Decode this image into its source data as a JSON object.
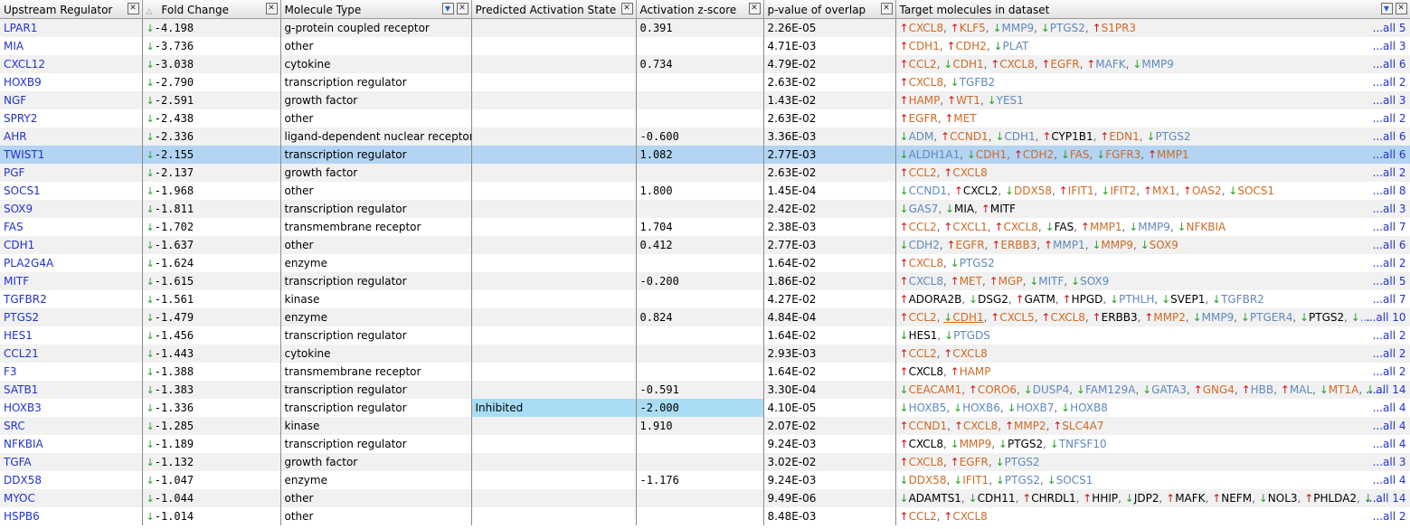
{
  "headers": [
    {
      "label": "Upstream Regulator",
      "buttons": [
        "x"
      ]
    },
    {
      "label": "Fold Change",
      "sort": "△",
      "buttons": [
        "x"
      ]
    },
    {
      "label": "Molecule Type",
      "buttons": [
        "filter",
        "x"
      ]
    },
    {
      "label": "Predicted Activation State",
      "buttons": [
        "x"
      ]
    },
    {
      "label": "Activation z-score",
      "buttons": [
        "x"
      ]
    },
    {
      "label": "p-value of overlap",
      "buttons": [
        "x"
      ]
    },
    {
      "label": "Target molecules in dataset",
      "buttons": [
        "filter",
        "x"
      ]
    }
  ],
  "rows": [
    {
      "regulator": "LPAR1",
      "fold": "-4.198",
      "type": "g-protein coupled receptor",
      "state": "",
      "z": "0.391",
      "p": "2.26E-05",
      "all": "...all 5",
      "targets": [
        [
          "CXCL8",
          "u",
          "o"
        ],
        [
          "KLF5",
          "u",
          "o"
        ],
        [
          "MMP9",
          "d",
          "b"
        ],
        [
          "PTGS2",
          "d",
          "b"
        ],
        [
          "S1PR3",
          "u",
          "o"
        ]
      ]
    },
    {
      "regulator": "MIA",
      "fold": "-3.736",
      "type": "other",
      "state": "",
      "z": "",
      "p": "4.71E-03",
      "all": "...all 3",
      "targets": [
        [
          "CDH1",
          "u",
          "o"
        ],
        [
          "CDH2",
          "u",
          "o"
        ],
        [
          "PLAT",
          "d",
          "b"
        ]
      ]
    },
    {
      "regulator": "CXCL12",
      "fold": "-3.038",
      "type": "cytokine",
      "state": "",
      "z": "0.734",
      "p": "4.79E-02",
      "all": "...all 6",
      "targets": [
        [
          "CCL2",
          "u",
          "o"
        ],
        [
          "CDH1",
          "d",
          "o"
        ],
        [
          "CXCL8",
          "u",
          "o"
        ],
        [
          "EGFR",
          "u",
          "o"
        ],
        [
          "MAFK",
          "u",
          "b"
        ],
        [
          "MMP9",
          "d",
          "b"
        ]
      ]
    },
    {
      "regulator": "HOXB9",
      "fold": "-2.790",
      "type": "transcription regulator",
      "state": "",
      "z": "",
      "p": "2.63E-02",
      "all": "...all 2",
      "targets": [
        [
          "CXCL8",
          "u",
          "o"
        ],
        [
          "TGFB2",
          "d",
          "b"
        ]
      ]
    },
    {
      "regulator": "NGF",
      "fold": "-2.591",
      "type": "growth factor",
      "state": "",
      "z": "",
      "p": "1.43E-02",
      "all": "...all 3",
      "targets": [
        [
          "HAMP",
          "u",
          "o"
        ],
        [
          "WT1",
          "u",
          "o"
        ],
        [
          "YES1",
          "d",
          "b"
        ]
      ]
    },
    {
      "regulator": "SPRY2",
      "fold": "-2.438",
      "type": "other",
      "state": "",
      "z": "",
      "p": "2.63E-02",
      "all": "...all 2",
      "targets": [
        [
          "EGFR",
          "u",
          "o"
        ],
        [
          "MET",
          "u",
          "o"
        ]
      ]
    },
    {
      "regulator": "AHR",
      "fold": "-2.336",
      "type": "ligand-dependent nuclear receptor",
      "state": "",
      "z": "-0.600",
      "p": "3.36E-03",
      "all": "...all 6",
      "targets": [
        [
          "ADM",
          "d",
          "b"
        ],
        [
          "CCND1",
          "u",
          "o"
        ],
        [
          "CDH1",
          "d",
          "b"
        ],
        [
          "CYP1B1",
          "u",
          "k"
        ],
        [
          "EDN1",
          "u",
          "o"
        ],
        [
          "PTGS2",
          "d",
          "b"
        ]
      ]
    },
    {
      "regulator": "TWIST1",
      "fold": "-2.155",
      "type": "transcription regulator",
      "state": "",
      "z": "1.082",
      "p": "2.77E-03",
      "all": "...all 6",
      "selected": true,
      "targets": [
        [
          "ALDH1A1",
          "d",
          "b"
        ],
        [
          "CDH1",
          "d",
          "o"
        ],
        [
          "CDH2",
          "u",
          "o"
        ],
        [
          "FAS",
          "d",
          "o"
        ],
        [
          "FGFR3",
          "d",
          "o"
        ],
        [
          "MMP1",
          "u",
          "o"
        ]
      ]
    },
    {
      "regulator": "PGF",
      "fold": "-2.137",
      "type": "growth factor",
      "state": "",
      "z": "",
      "p": "2.63E-02",
      "all": "...all 2",
      "targets": [
        [
          "CCL2",
          "u",
          "o"
        ],
        [
          "CXCL8",
          "u",
          "o"
        ]
      ]
    },
    {
      "regulator": "SOCS1",
      "fold": "-1.968",
      "type": "other",
      "state": "",
      "z": "1.800",
      "p": "1.45E-04",
      "all": "...all 8",
      "targets": [
        [
          "CCND1",
          "d",
          "b"
        ],
        [
          "CXCL2",
          "u",
          "k"
        ],
        [
          "DDX58",
          "d",
          "o"
        ],
        [
          "IFIT1",
          "u",
          "o"
        ],
        [
          "IFIT2",
          "d",
          "o"
        ],
        [
          "MX1",
          "u",
          "o"
        ],
        [
          "OAS2",
          "u",
          "o"
        ],
        [
          "SOCS1",
          "d",
          "o"
        ]
      ]
    },
    {
      "regulator": "SOX9",
      "fold": "-1.811",
      "type": "transcription regulator",
      "state": "",
      "z": "",
      "p": "2.42E-02",
      "all": "...all 3",
      "targets": [
        [
          "GAS7",
          "d",
          "b"
        ],
        [
          "MIA",
          "d",
          "k"
        ],
        [
          "MITF",
          "u",
          "k"
        ]
      ]
    },
    {
      "regulator": "FAS",
      "fold": "-1.702",
      "type": "transmembrane receptor",
      "state": "",
      "z": "1.704",
      "p": "2.38E-03",
      "all": "...all 7",
      "targets": [
        [
          "CCL2",
          "u",
          "o"
        ],
        [
          "CXCL1",
          "u",
          "o"
        ],
        [
          "CXCL8",
          "u",
          "o"
        ],
        [
          "FAS",
          "d",
          "k"
        ],
        [
          "MMP1",
          "u",
          "o"
        ],
        [
          "MMP9",
          "d",
          "b"
        ],
        [
          "NFKBIA",
          "d",
          "o"
        ]
      ]
    },
    {
      "regulator": "CDH1",
      "fold": "-1.637",
      "type": "other",
      "state": "",
      "z": "0.412",
      "p": "2.77E-03",
      "all": "...all 6",
      "targets": [
        [
          "CDH2",
          "d",
          "b"
        ],
        [
          "EGFR",
          "u",
          "o"
        ],
        [
          "ERBB3",
          "u",
          "o"
        ],
        [
          "MMP1",
          "u",
          "b"
        ],
        [
          "MMP9",
          "d",
          "o"
        ],
        [
          "SOX9",
          "d",
          "o"
        ]
      ]
    },
    {
      "regulator": "PLA2G4A",
      "fold": "-1.624",
      "type": "enzyme",
      "state": "",
      "z": "",
      "p": "1.64E-02",
      "all": "...all 2",
      "targets": [
        [
          "CXCL8",
          "u",
          "o"
        ],
        [
          "PTGS2",
          "d",
          "b"
        ]
      ]
    },
    {
      "regulator": "MITF",
      "fold": "-1.615",
      "type": "transcription regulator",
      "state": "",
      "z": "-0.200",
      "p": "1.86E-02",
      "all": "...all 5",
      "targets": [
        [
          "CXCL8",
          "u",
          "b"
        ],
        [
          "MET",
          "u",
          "o"
        ],
        [
          "MGP",
          "u",
          "o"
        ],
        [
          "MITF",
          "d",
          "b"
        ],
        [
          "SOX9",
          "d",
          "b"
        ]
      ]
    },
    {
      "regulator": "TGFBR2",
      "fold": "-1.561",
      "type": "kinase",
      "state": "",
      "z": "",
      "p": "4.27E-02",
      "all": "...all 7",
      "targets": [
        [
          "ADORA2B",
          "u",
          "k"
        ],
        [
          "DSG2",
          "d",
          "k"
        ],
        [
          "GATM",
          "u",
          "k"
        ],
        [
          "HPGD",
          "u",
          "k"
        ],
        [
          "PTHLH",
          "d",
          "b"
        ],
        [
          "SVEP1",
          "d",
          "k"
        ],
        [
          "TGFBR2",
          "d",
          "b"
        ]
      ]
    },
    {
      "regulator": "PTGS2",
      "fold": "-1.479",
      "type": "enzyme",
      "state": "",
      "z": "0.824",
      "p": "4.84E-04",
      "all": "...all 10",
      "targets": [
        [
          "CCL2",
          "u",
          "o"
        ],
        [
          "CDH1",
          "d",
          "o",
          "ul"
        ],
        [
          "CXCL5",
          "u",
          "o"
        ],
        [
          "CXCL8",
          "u",
          "o"
        ],
        [
          "ERBB3",
          "u",
          "k"
        ],
        [
          "MMP2",
          "u",
          "o"
        ],
        [
          "MMP9",
          "d",
          "b"
        ],
        [
          "PTGER4",
          "d",
          "b"
        ],
        [
          "PTGS2",
          "d",
          "k"
        ],
        [
          "...",
          "d",
          "b"
        ]
      ]
    },
    {
      "regulator": "HES1",
      "fold": "-1.456",
      "type": "transcription regulator",
      "state": "",
      "z": "",
      "p": "1.64E-02",
      "all": "...all 2",
      "targets": [
        [
          "HES1",
          "d",
          "k"
        ],
        [
          "PTGDS",
          "d",
          "b"
        ]
      ]
    },
    {
      "regulator": "CCL21",
      "fold": "-1.443",
      "type": "cytokine",
      "state": "",
      "z": "",
      "p": "2.93E-03",
      "all": "...all 2",
      "targets": [
        [
          "CCL2",
          "u",
          "o"
        ],
        [
          "CXCL8",
          "u",
          "o"
        ]
      ]
    },
    {
      "regulator": "F3",
      "fold": "-1.388",
      "type": "transmembrane receptor",
      "state": "",
      "z": "",
      "p": "1.64E-02",
      "all": "...all 2",
      "targets": [
        [
          "CXCL8",
          "u",
          "k"
        ],
        [
          "HAMP",
          "u",
          "o"
        ]
      ]
    },
    {
      "regulator": "SATB1",
      "fold": "-1.383",
      "type": "transcription regulator",
      "state": "",
      "z": "-0.591",
      "p": "3.30E-04",
      "all": "...all 14",
      "targets": [
        [
          "CEACAM1",
          "d",
          "o"
        ],
        [
          "CORO6",
          "u",
          "o"
        ],
        [
          "DUSP4",
          "d",
          "b"
        ],
        [
          "FAM129A",
          "d",
          "b"
        ],
        [
          "GATA3",
          "d",
          "b"
        ],
        [
          "GNG4",
          "u",
          "o"
        ],
        [
          "HBB",
          "u",
          "b"
        ],
        [
          "MAL",
          "u",
          "b"
        ],
        [
          "MT1A",
          "d",
          "o"
        ],
        [
          "...",
          "d",
          "b"
        ]
      ]
    },
    {
      "regulator": "HOXB3",
      "fold": "-1.336",
      "type": "transcription regulator",
      "state": "Inhibited",
      "z": "-2.000",
      "p": "4.10E-05",
      "all": "...all 4",
      "inhibited": true,
      "targets": [
        [
          "HOXB5",
          "d",
          "b"
        ],
        [
          "HOXB6",
          "d",
          "b"
        ],
        [
          "HOXB7",
          "d",
          "b"
        ],
        [
          "HOXB8",
          "d",
          "b"
        ]
      ]
    },
    {
      "regulator": "SRC",
      "fold": "-1.285",
      "type": "kinase",
      "state": "",
      "z": "1.910",
      "p": "2.07E-02",
      "all": "...all 4",
      "targets": [
        [
          "CCND1",
          "u",
          "o"
        ],
        [
          "CXCL8",
          "u",
          "o"
        ],
        [
          "MMP2",
          "u",
          "o"
        ],
        [
          "SLC4A7",
          "u",
          "o"
        ]
      ]
    },
    {
      "regulator": "NFKBIA",
      "fold": "-1.189",
      "type": "transcription regulator",
      "state": "",
      "z": "",
      "p": "9.24E-03",
      "all": "...all 4",
      "targets": [
        [
          "CXCL8",
          "u",
          "k"
        ],
        [
          "MMP9",
          "d",
          "o"
        ],
        [
          "PTGS2",
          "d",
          "k"
        ],
        [
          "TNFSF10",
          "d",
          "b"
        ]
      ]
    },
    {
      "regulator": "TGFA",
      "fold": "-1.132",
      "type": "growth factor",
      "state": "",
      "z": "",
      "p": "3.02E-02",
      "all": "...all 3",
      "targets": [
        [
          "CXCL8",
          "u",
          "o"
        ],
        [
          "EGFR",
          "u",
          "o"
        ],
        [
          "PTGS2",
          "d",
          "b"
        ]
      ]
    },
    {
      "regulator": "DDX58",
      "fold": "-1.047",
      "type": "enzyme",
      "state": "",
      "z": "-1.176",
      "p": "9.24E-03",
      "all": "...all 4",
      "targets": [
        [
          "DDX58",
          "d",
          "o"
        ],
        [
          "IFIT1",
          "d",
          "o"
        ],
        [
          "PTGS2",
          "d",
          "b"
        ],
        [
          "SOCS1",
          "d",
          "b"
        ]
      ]
    },
    {
      "regulator": "MYOC",
      "fold": "-1.044",
      "type": "other",
      "state": "",
      "z": "",
      "p": "9.49E-06",
      "all": "...all 14",
      "targets": [
        [
          "ADAMTS1",
          "d",
          "k"
        ],
        [
          "CDH11",
          "d",
          "k"
        ],
        [
          "CHRDL1",
          "u",
          "k"
        ],
        [
          "HHIP",
          "u",
          "k"
        ],
        [
          "JDP2",
          "d",
          "k"
        ],
        [
          "MAFK",
          "u",
          "k"
        ],
        [
          "NEFM",
          "u",
          "k"
        ],
        [
          "NOL3",
          "d",
          "k"
        ],
        [
          "PHLDA2",
          "u",
          "k"
        ],
        [
          "...",
          "d",
          "k"
        ]
      ]
    },
    {
      "regulator": "HSPB6",
      "fold": "-1.014",
      "type": "other",
      "state": "",
      "z": "",
      "p": "8.48E-03",
      "all": "...all 2",
      "targets": [
        [
          "CCL2",
          "u",
          "o"
        ],
        [
          "CXCL8",
          "u",
          "o"
        ]
      ]
    }
  ]
}
